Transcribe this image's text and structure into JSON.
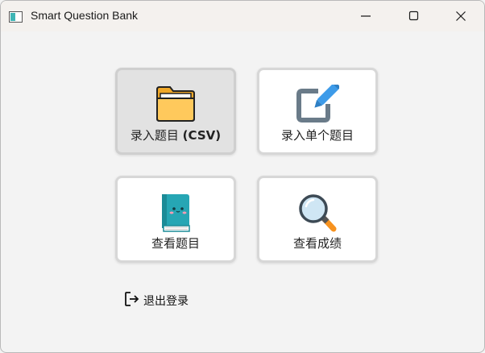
{
  "window": {
    "title": "Smart Question Bank",
    "controls": {
      "minimize": "minimize-icon",
      "maximize": "maximize-icon",
      "close": "close-icon"
    }
  },
  "tiles": [
    {
      "label": "录入题目 ",
      "label_bold": "(CSV)",
      "icon": "folder-icon",
      "state": "hover"
    },
    {
      "label": "录入单个题目",
      "icon": "edit-icon"
    },
    {
      "label": "查看题目",
      "icon": "book-icon"
    },
    {
      "label": "查看成绩",
      "icon": "magnifier-icon"
    }
  ],
  "logout": {
    "label": "退出登录",
    "icon": "logout-icon"
  },
  "colors": {
    "window_bg": "#f3f3f3",
    "tile_bg": "#ffffff",
    "tile_hover_bg": "#e2e2e2",
    "folder": "#ffc95c",
    "pencil": "#3d9be9",
    "book": "#26a6b4",
    "magnifier_handle": "#f7921e"
  }
}
